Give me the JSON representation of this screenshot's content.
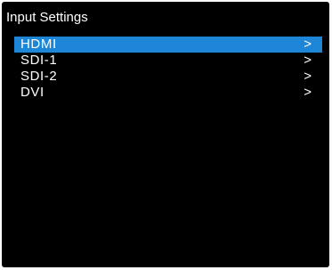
{
  "screen": {
    "title": "Input Settings"
  },
  "menu": {
    "items": [
      {
        "label": "HDMI",
        "arrow": ">",
        "selected": true
      },
      {
        "label": "SDI-1",
        "arrow": ">",
        "selected": false
      },
      {
        "label": "SDI-2",
        "arrow": ">",
        "selected": false
      },
      {
        "label": "DVI",
        "arrow": ">",
        "selected": false
      }
    ]
  },
  "colors": {
    "background": "#000000",
    "highlight": "#1e86d6",
    "text": "#ffffff"
  }
}
